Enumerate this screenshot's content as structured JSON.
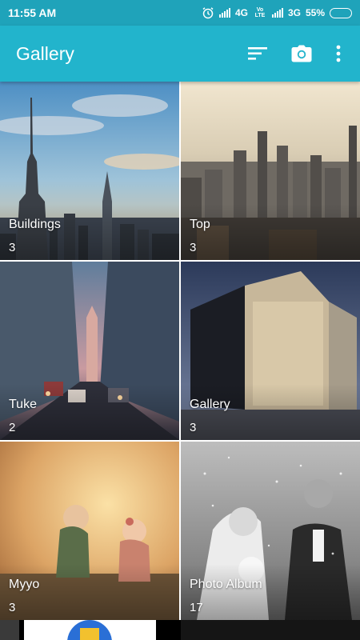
{
  "status_bar": {
    "time": "11:55 AM",
    "network_1": "4G",
    "network_1_sub": "Vo LTE",
    "network_2": "3G",
    "battery": "55%",
    "battery_level": 0.55
  },
  "app_bar": {
    "title": "Gallery",
    "icons": [
      "sort-icon",
      "camera-icon",
      "more-vert-icon"
    ]
  },
  "albums": [
    {
      "name": "Buildings",
      "count": "3"
    },
    {
      "name": "Top",
      "count": "3"
    },
    {
      "name": "Tuke",
      "count": "2"
    },
    {
      "name": "Gallery",
      "count": "3"
    },
    {
      "name": "Myyo",
      "count": "3"
    },
    {
      "name": "Photo Album",
      "count": "17"
    }
  ],
  "colors": {
    "status_bar": "#1fa3ba",
    "app_bar": "#22b4cc",
    "text_on_primary": "#ffffff"
  }
}
